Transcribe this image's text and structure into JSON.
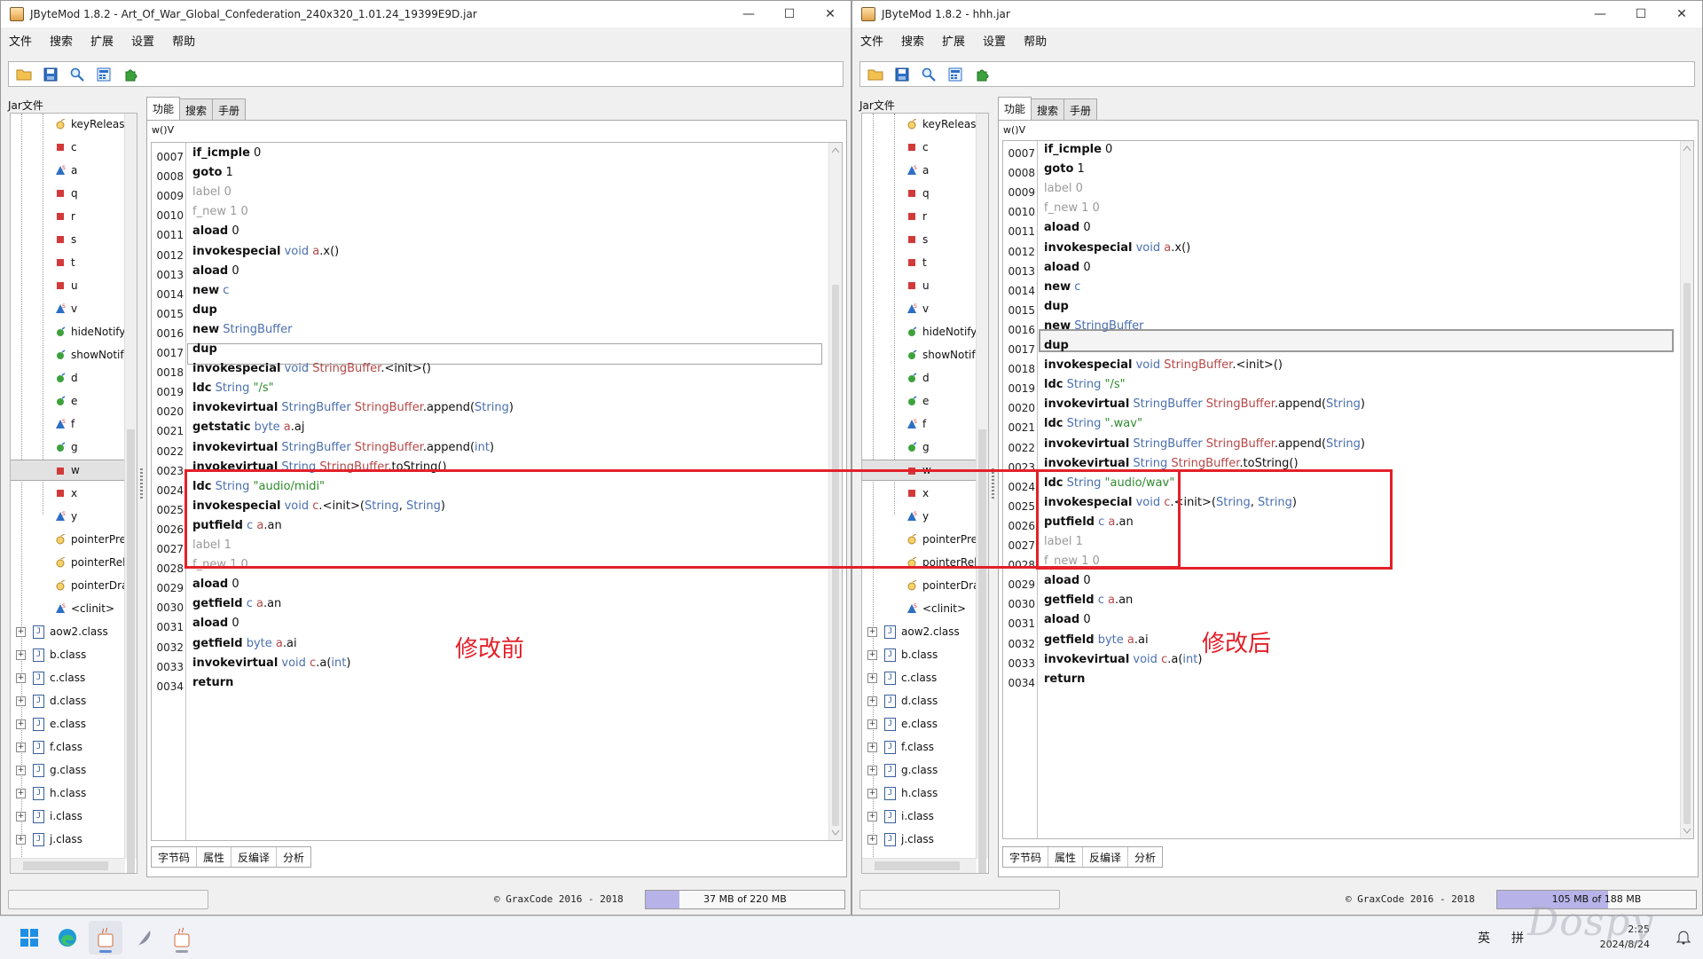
{
  "left_window": {
    "title": "JByteMod 1.8.2 - Art_Of_War_Global_Confederation_240x320_1.01.24_19399E9D.jar",
    "memory": {
      "text": "37 MB of 220 MB",
      "fraction": 0.17
    },
    "annotation": "修改前",
    "lines": [
      {
        "n": "0007",
        "segs": [
          [
            "op",
            "if_icmple"
          ],
          [
            "num",
            " 0"
          ]
        ]
      },
      {
        "n": "0008",
        "segs": [
          [
            "op",
            "goto"
          ],
          [
            "num",
            " 1"
          ]
        ]
      },
      {
        "n": "0009",
        "dim": true,
        "segs": [
          [
            "op",
            "label"
          ],
          [
            "label",
            " 0"
          ]
        ]
      },
      {
        "n": "0010",
        "dim": true,
        "segs": [
          [
            "op",
            "f_new"
          ],
          [
            "label",
            " 1 0"
          ]
        ]
      },
      {
        "n": "0011",
        "segs": [
          [
            "op",
            "aload"
          ],
          [
            "num",
            " 0"
          ]
        ]
      },
      {
        "n": "0012",
        "segs": [
          [
            "op",
            "invokespecial"
          ],
          [
            "type",
            " void"
          ],
          [
            "name",
            " a"
          ],
          [
            "num",
            ".x()"
          ]
        ]
      },
      {
        "n": "0013",
        "segs": [
          [
            "op",
            "aload"
          ],
          [
            "num",
            " 0"
          ]
        ]
      },
      {
        "n": "0014",
        "segs": [
          [
            "op",
            "new"
          ],
          [
            "type",
            " c"
          ]
        ]
      },
      {
        "n": "0015",
        "segs": [
          [
            "op",
            "dup"
          ]
        ]
      },
      {
        "n": "0016",
        "segs": [
          [
            "op",
            "new"
          ],
          [
            "type",
            " StringBuffer"
          ]
        ]
      },
      {
        "n": "0017",
        "segs": [
          [
            "op",
            "dup"
          ]
        ]
      },
      {
        "n": "0018",
        "segs": [
          [
            "op",
            "invokespecial"
          ],
          [
            "type",
            " void"
          ],
          [
            "name",
            " StringBuffer"
          ],
          [
            "num",
            "."
          ],
          [
            "num",
            "<init>()"
          ]
        ]
      },
      {
        "n": "0019",
        "segs": [
          [
            "op",
            "ldc"
          ],
          [
            "type",
            " String"
          ],
          [
            "str",
            " \"/s\""
          ]
        ]
      },
      {
        "n": "0020",
        "segs": [
          [
            "op",
            "invokevirtual"
          ],
          [
            "type",
            " StringBuffer"
          ],
          [
            "name",
            " StringBuffer"
          ],
          [
            "num",
            ".append("
          ],
          [
            "type",
            "String"
          ],
          [
            "num",
            ")"
          ]
        ]
      },
      {
        "n": "0021",
        "segs": [
          [
            "op",
            "getstatic"
          ],
          [
            "type",
            " byte"
          ],
          [
            "name",
            " a"
          ],
          [
            "num",
            ".aj"
          ]
        ]
      },
      {
        "n": "0022",
        "segs": [
          [
            "op",
            "invokevirtual"
          ],
          [
            "type",
            " StringBuffer"
          ],
          [
            "name",
            " StringBuffer"
          ],
          [
            "num",
            ".append("
          ],
          [
            "type",
            "int"
          ],
          [
            "num",
            ")"
          ]
        ]
      },
      {
        "n": "0023",
        "segs": [
          [
            "op",
            "invokevirtual"
          ],
          [
            "type",
            " String"
          ],
          [
            "name",
            " StringBuffer"
          ],
          [
            "num",
            ".toString()"
          ]
        ]
      },
      {
        "n": "0024",
        "segs": [
          [
            "op",
            "ldc"
          ],
          [
            "type",
            " String"
          ],
          [
            "str",
            " \"audio/midi\""
          ]
        ]
      },
      {
        "n": "0025",
        "segs": [
          [
            "op",
            "invokespecial"
          ],
          [
            "type",
            " void"
          ],
          [
            "name",
            " c"
          ],
          [
            "num",
            "."
          ],
          [
            "num",
            "<init>("
          ],
          [
            "type",
            "String"
          ],
          [
            "num",
            ", "
          ],
          [
            "type",
            "String"
          ],
          [
            "num",
            ")"
          ]
        ]
      },
      {
        "n": "0026",
        "segs": [
          [
            "op",
            "putfield"
          ],
          [
            "type",
            " c"
          ],
          [
            "name",
            " a"
          ],
          [
            "num",
            ".an"
          ]
        ]
      },
      {
        "n": "0027",
        "dim": true,
        "segs": [
          [
            "op",
            "label"
          ],
          [
            "label",
            " 1"
          ]
        ]
      },
      {
        "n": "0028",
        "dim": true,
        "segs": [
          [
            "op",
            "f_new"
          ],
          [
            "label",
            " 1 0"
          ]
        ]
      },
      {
        "n": "0029",
        "segs": [
          [
            "op",
            "aload"
          ],
          [
            "num",
            " 0"
          ]
        ]
      },
      {
        "n": "0030",
        "segs": [
          [
            "op",
            "getfield"
          ],
          [
            "type",
            " c"
          ],
          [
            "name",
            " a"
          ],
          [
            "num",
            ".an"
          ]
        ]
      },
      {
        "n": "0031",
        "segs": [
          [
            "op",
            "aload"
          ],
          [
            "num",
            " 0"
          ]
        ]
      },
      {
        "n": "0032",
        "segs": [
          [
            "op",
            "getfield"
          ],
          [
            "type",
            " byte"
          ],
          [
            "name",
            " a"
          ],
          [
            "num",
            ".ai"
          ]
        ]
      },
      {
        "n": "0033",
        "segs": [
          [
            "op",
            "invokevirtual"
          ],
          [
            "type",
            " void"
          ],
          [
            "name",
            " c"
          ],
          [
            "num",
            ".a("
          ],
          [
            "type",
            "int"
          ],
          [
            "num",
            ")"
          ]
        ]
      },
      {
        "n": "0034",
        "segs": [
          [
            "op",
            "return"
          ]
        ]
      }
    ]
  },
  "right_window": {
    "title": "JByteMod 1.8.2 - hhh.jar",
    "memory": {
      "text": "105 MB of 188 MB",
      "fraction": 0.56
    },
    "annotation": "修改后",
    "lines": [
      {
        "n": "0007",
        "segs": [
          [
            "op",
            "if_icmple"
          ],
          [
            "num",
            " 0"
          ]
        ]
      },
      {
        "n": "0008",
        "segs": [
          [
            "op",
            "goto"
          ],
          [
            "num",
            " 1"
          ]
        ]
      },
      {
        "n": "0009",
        "dim": true,
        "segs": [
          [
            "op",
            "label"
          ],
          [
            "label",
            " 0"
          ]
        ]
      },
      {
        "n": "0010",
        "dim": true,
        "segs": [
          [
            "op",
            "f_new"
          ],
          [
            "label",
            " 1 0"
          ]
        ]
      },
      {
        "n": "0011",
        "segs": [
          [
            "op",
            "aload"
          ],
          [
            "num",
            " 0"
          ]
        ]
      },
      {
        "n": "0012",
        "segs": [
          [
            "op",
            "invokespecial"
          ],
          [
            "type",
            " void"
          ],
          [
            "name",
            " a"
          ],
          [
            "num",
            ".x()"
          ]
        ]
      },
      {
        "n": "0013",
        "segs": [
          [
            "op",
            "aload"
          ],
          [
            "num",
            " 0"
          ]
        ]
      },
      {
        "n": "0014",
        "segs": [
          [
            "op",
            "new"
          ],
          [
            "type",
            " c"
          ]
        ]
      },
      {
        "n": "0015",
        "segs": [
          [
            "op",
            "dup"
          ]
        ]
      },
      {
        "n": "0016",
        "segs": [
          [
            "op",
            "new"
          ],
          [
            "type",
            " StringBuffer"
          ]
        ]
      },
      {
        "n": "0017",
        "segs": [
          [
            "op",
            "dup"
          ]
        ]
      },
      {
        "n": "0018",
        "segs": [
          [
            "op",
            "invokespecial"
          ],
          [
            "type",
            " void"
          ],
          [
            "name",
            " StringBuffer"
          ],
          [
            "num",
            "."
          ],
          [
            "num",
            "<init>()"
          ]
        ]
      },
      {
        "n": "0019",
        "segs": [
          [
            "op",
            "ldc"
          ],
          [
            "type",
            " String"
          ],
          [
            "str",
            " \"/s\""
          ]
        ]
      },
      {
        "n": "0020",
        "segs": [
          [
            "op",
            "invokevirtual"
          ],
          [
            "type",
            " StringBuffer"
          ],
          [
            "name",
            " StringBuffer"
          ],
          [
            "num",
            ".append("
          ],
          [
            "type",
            "String"
          ],
          [
            "num",
            ")"
          ]
        ]
      },
      {
        "n": "0021",
        "segs": [
          [
            "op",
            "ldc"
          ],
          [
            "type",
            " String"
          ],
          [
            "str",
            " \".wav\""
          ]
        ]
      },
      {
        "n": "0022",
        "segs": [
          [
            "op",
            "invokevirtual"
          ],
          [
            "type",
            " StringBuffer"
          ],
          [
            "name",
            " StringBuffer"
          ],
          [
            "num",
            ".append("
          ],
          [
            "type",
            "String"
          ],
          [
            "num",
            ")"
          ]
        ]
      },
      {
        "n": "0023",
        "segs": [
          [
            "op",
            "invokevirtual"
          ],
          [
            "type",
            " String"
          ],
          [
            "name",
            " StringBuffer"
          ],
          [
            "num",
            ".toString()"
          ]
        ]
      },
      {
        "n": "0024",
        "segs": [
          [
            "op",
            "ldc"
          ],
          [
            "type",
            " String"
          ],
          [
            "str",
            " \"audio/wav\""
          ]
        ]
      },
      {
        "n": "0025",
        "segs": [
          [
            "op",
            "invokespecial"
          ],
          [
            "type",
            " void"
          ],
          [
            "name",
            " c"
          ],
          [
            "num",
            "."
          ],
          [
            "num",
            "<init>("
          ],
          [
            "type",
            "String"
          ],
          [
            "num",
            ", "
          ],
          [
            "type",
            "String"
          ],
          [
            "num",
            ")"
          ]
        ]
      },
      {
        "n": "0026",
        "segs": [
          [
            "op",
            "putfield"
          ],
          [
            "type",
            " c"
          ],
          [
            "name",
            " a"
          ],
          [
            "num",
            ".an"
          ]
        ]
      },
      {
        "n": "0027",
        "dim": true,
        "segs": [
          [
            "op",
            "label"
          ],
          [
            "label",
            " 1"
          ]
        ]
      },
      {
        "n": "0028",
        "dim": true,
        "segs": [
          [
            "op",
            "f_new"
          ],
          [
            "label",
            " 1 0"
          ]
        ]
      },
      {
        "n": "0029",
        "segs": [
          [
            "op",
            "aload"
          ],
          [
            "num",
            " 0"
          ]
        ]
      },
      {
        "n": "0030",
        "segs": [
          [
            "op",
            "getfield"
          ],
          [
            "type",
            " c"
          ],
          [
            "name",
            " a"
          ],
          [
            "num",
            ".an"
          ]
        ]
      },
      {
        "n": "0031",
        "segs": [
          [
            "op",
            "aload"
          ],
          [
            "num",
            " 0"
          ]
        ]
      },
      {
        "n": "0032",
        "segs": [
          [
            "op",
            "getfield"
          ],
          [
            "type",
            " byte"
          ],
          [
            "name",
            " a"
          ],
          [
            "num",
            ".ai"
          ]
        ]
      },
      {
        "n": "0033",
        "segs": [
          [
            "op",
            "invokevirtual"
          ],
          [
            "type",
            " void"
          ],
          [
            "name",
            " c"
          ],
          [
            "num",
            ".a("
          ],
          [
            "type",
            "int"
          ],
          [
            "num",
            ")"
          ]
        ]
      },
      {
        "n": "0034",
        "segs": [
          [
            "op",
            "return"
          ]
        ]
      }
    ]
  },
  "menu": [
    "文件",
    "搜索",
    "扩展",
    "设置",
    "帮助"
  ],
  "toolbar_icons": [
    "open-folder-icon",
    "save-icon",
    "search-icon",
    "calculator-icon",
    "plugin-icon"
  ],
  "jar_label": "Jar文件",
  "tabs": [
    "功能",
    "搜索",
    "手册"
  ],
  "method_signature": "w()V",
  "bottom_tabs": [
    "字节码",
    "属性",
    "反编译",
    "分析"
  ],
  "copyright": "© GraxCode 2016 - 2018",
  "members": [
    {
      "label": "keyReleas",
      "kind": "method-key"
    },
    {
      "label": "c",
      "kind": "field"
    },
    {
      "label": "a",
      "kind": "static"
    },
    {
      "label": "q",
      "kind": "field"
    },
    {
      "label": "r",
      "kind": "field"
    },
    {
      "label": "s",
      "kind": "field"
    },
    {
      "label": "t",
      "kind": "field"
    },
    {
      "label": "u",
      "kind": "field"
    },
    {
      "label": "v",
      "kind": "static"
    },
    {
      "label": "hideNotify",
      "kind": "method"
    },
    {
      "label": "showNotif",
      "kind": "method"
    },
    {
      "label": "d",
      "kind": "method"
    },
    {
      "label": "e",
      "kind": "method"
    },
    {
      "label": "f",
      "kind": "static"
    },
    {
      "label": "g",
      "kind": "method"
    },
    {
      "label": "w",
      "kind": "field",
      "selected": true
    },
    {
      "label": "x",
      "kind": "field"
    },
    {
      "label": "y",
      "kind": "static"
    },
    {
      "label": "pointerPre",
      "kind": "method-key"
    },
    {
      "label": "pointerRel",
      "kind": "method-key"
    },
    {
      "label": "pointerDra",
      "kind": "method-key"
    },
    {
      "label": "<clinit>",
      "kind": "static"
    }
  ],
  "classes": [
    "aow2.class",
    "b.class",
    "c.class",
    "d.class",
    "e.class",
    "f.class",
    "g.class",
    "h.class",
    "i.class",
    "j.class"
  ],
  "window_controls": [
    "—",
    "☐",
    "✕"
  ],
  "taskbar": {
    "apps": [
      "windows-start-icon",
      "edge-icon",
      "java-icon",
      "feather-icon",
      "java-icon"
    ],
    "ime": [
      "英",
      "拼"
    ],
    "time": "2:25",
    "date": "2024/8/24"
  },
  "watermark": "Dospy"
}
